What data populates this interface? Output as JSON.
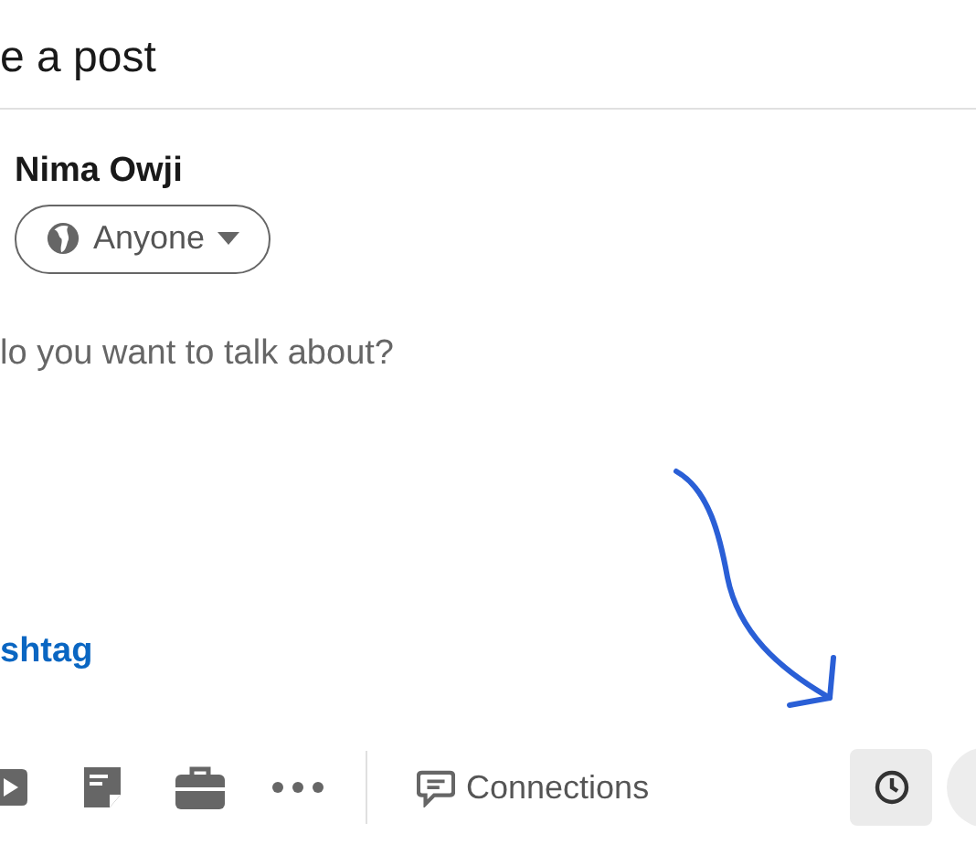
{
  "dialog": {
    "title": "e a post"
  },
  "author": {
    "name": "Nima Owji",
    "audience": "Anyone"
  },
  "editor": {
    "placeholder": "lo you want to talk about?"
  },
  "hashtag_link": "shtag",
  "toolbar": {
    "audience_label": "Connections"
  }
}
